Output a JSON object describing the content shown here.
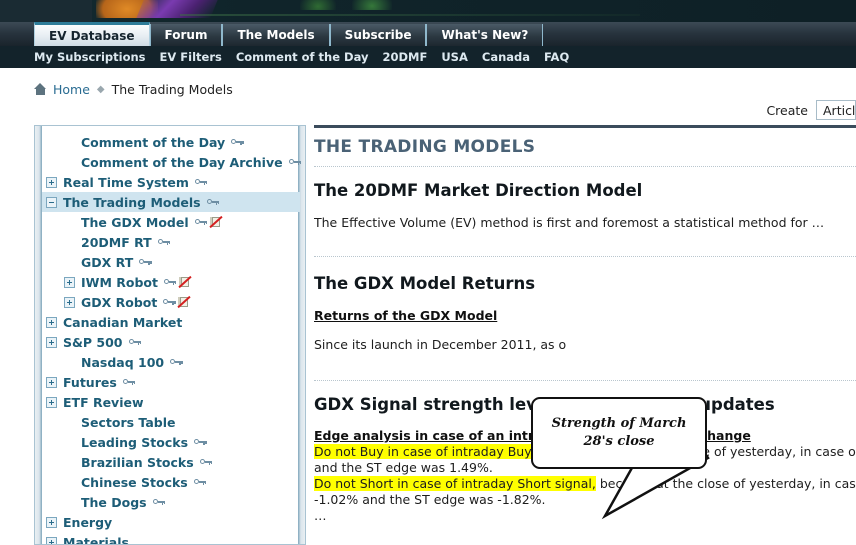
{
  "site": {
    "banner_alt": "site-banner"
  },
  "tabs": [
    {
      "label": "EV Database",
      "active": true
    },
    {
      "label": "Forum",
      "active": false
    },
    {
      "label": "The Models",
      "active": false
    },
    {
      "label": "Subscribe",
      "active": false
    },
    {
      "label": "What's New?",
      "active": false
    }
  ],
  "subnav": [
    {
      "label": "My Subscriptions"
    },
    {
      "label": "EV Filters"
    },
    {
      "label": "Comment of the Day"
    },
    {
      "label": "20DMF"
    },
    {
      "label": "USA"
    },
    {
      "label": "Canada"
    },
    {
      "label": "FAQ"
    }
  ],
  "breadcrumb": {
    "home": "Home",
    "separator": "◆",
    "current": "The Trading Models"
  },
  "create": {
    "label": "Create",
    "selected": "Article"
  },
  "sidebar": {
    "items": [
      {
        "label": "Comment of the Day",
        "indent": 1,
        "expander": "none",
        "key": true,
        "book": false,
        "selected": false
      },
      {
        "label": "Comment of the Day Archive",
        "indent": 1,
        "expander": "none",
        "key": true,
        "book": false,
        "selected": false
      },
      {
        "label": "Real Time System",
        "indent": 0,
        "expander": "plus",
        "key": true,
        "book": false,
        "selected": false
      },
      {
        "label": "The Trading Models",
        "indent": 0,
        "expander": "minus",
        "key": true,
        "book": false,
        "selected": true
      },
      {
        "label": "The GDX Model",
        "indent": 2,
        "expander": "none",
        "key": true,
        "book": true,
        "selected": false
      },
      {
        "label": "20DMF RT",
        "indent": 2,
        "expander": "none",
        "key": true,
        "book": false,
        "selected": false
      },
      {
        "label": "GDX RT",
        "indent": 2,
        "expander": "none",
        "key": true,
        "book": false,
        "selected": false
      },
      {
        "label": "IWM Robot",
        "indent": 1,
        "expander": "plus",
        "key": true,
        "book": true,
        "selected": false
      },
      {
        "label": "GDX Robot",
        "indent": 1,
        "expander": "plus",
        "key": true,
        "book": true,
        "selected": false
      },
      {
        "label": "Canadian Market",
        "indent": 0,
        "expander": "plus",
        "key": false,
        "book": false,
        "selected": false
      },
      {
        "label": "S&P 500",
        "indent": 0,
        "expander": "plus",
        "key": true,
        "book": false,
        "selected": false
      },
      {
        "label": "Nasdaq 100",
        "indent": 1,
        "expander": "none",
        "key": true,
        "book": false,
        "selected": false
      },
      {
        "label": "Futures",
        "indent": 0,
        "expander": "plus",
        "key": true,
        "book": false,
        "selected": false
      },
      {
        "label": "ETF Review",
        "indent": 0,
        "expander": "plus",
        "key": false,
        "book": false,
        "selected": false
      },
      {
        "label": "Sectors Table",
        "indent": 1,
        "expander": "none",
        "key": false,
        "book": false,
        "selected": false
      },
      {
        "label": "Leading Stocks",
        "indent": 1,
        "expander": "none",
        "key": true,
        "book": false,
        "selected": false
      },
      {
        "label": "Brazilian Stocks",
        "indent": 1,
        "expander": "none",
        "key": true,
        "book": false,
        "selected": false
      },
      {
        "label": "Chinese Stocks",
        "indent": 1,
        "expander": "none",
        "key": true,
        "book": false,
        "selected": false
      },
      {
        "label": "The Dogs",
        "indent": 1,
        "expander": "none",
        "key": true,
        "book": false,
        "selected": false
      },
      {
        "label": "Energy",
        "indent": 0,
        "expander": "plus",
        "key": false,
        "book": false,
        "selected": false
      },
      {
        "label": "Materials",
        "indent": 0,
        "expander": "plus",
        "key": false,
        "book": false,
        "selected": false
      }
    ]
  },
  "main": {
    "page_title": "THE TRADING MODELS",
    "section1": {
      "heading": "The 20DMF Market Direction Model",
      "paragraph": "The Effective Volume (EV) method is first and foremost a statistical method for …"
    },
    "section2": {
      "heading": "The GDX Model Returns",
      "link": "Returns of the GDX Model",
      "paragraph": "Since its launch in December 2011, as o"
    },
    "section3": {
      "heading": "GDX Signal strength levels and real time updates",
      "subheading": "Edge analysis in case of an intraday real time GDX MF change",
      "line1_highlight": "Do not Buy in case of intraday Buy signal,",
      "line1_rest": " because at the close of yesterday, in case of a Buy signal",
      "line2": "and the ST edge was 1.49%.",
      "line3_highlight": "Do not Short in case of intraday Short signal,",
      "line3_rest": " because at the close of yesterday, in case of a Short",
      "line4": "-1.02% and the ST edge was -1.82%.",
      "line5": "…"
    }
  },
  "callout": {
    "text": "Strength of March 28's close"
  },
  "colors": {
    "tab_active_accent": "#2e7d99",
    "navbar_dark": "#13232b",
    "sidebar_selected": "#cfe4ef",
    "sidebar_label": "#1d5d77",
    "page_title": "#4a6276",
    "highlight": "#ffff00",
    "link": "#2a6c92"
  }
}
